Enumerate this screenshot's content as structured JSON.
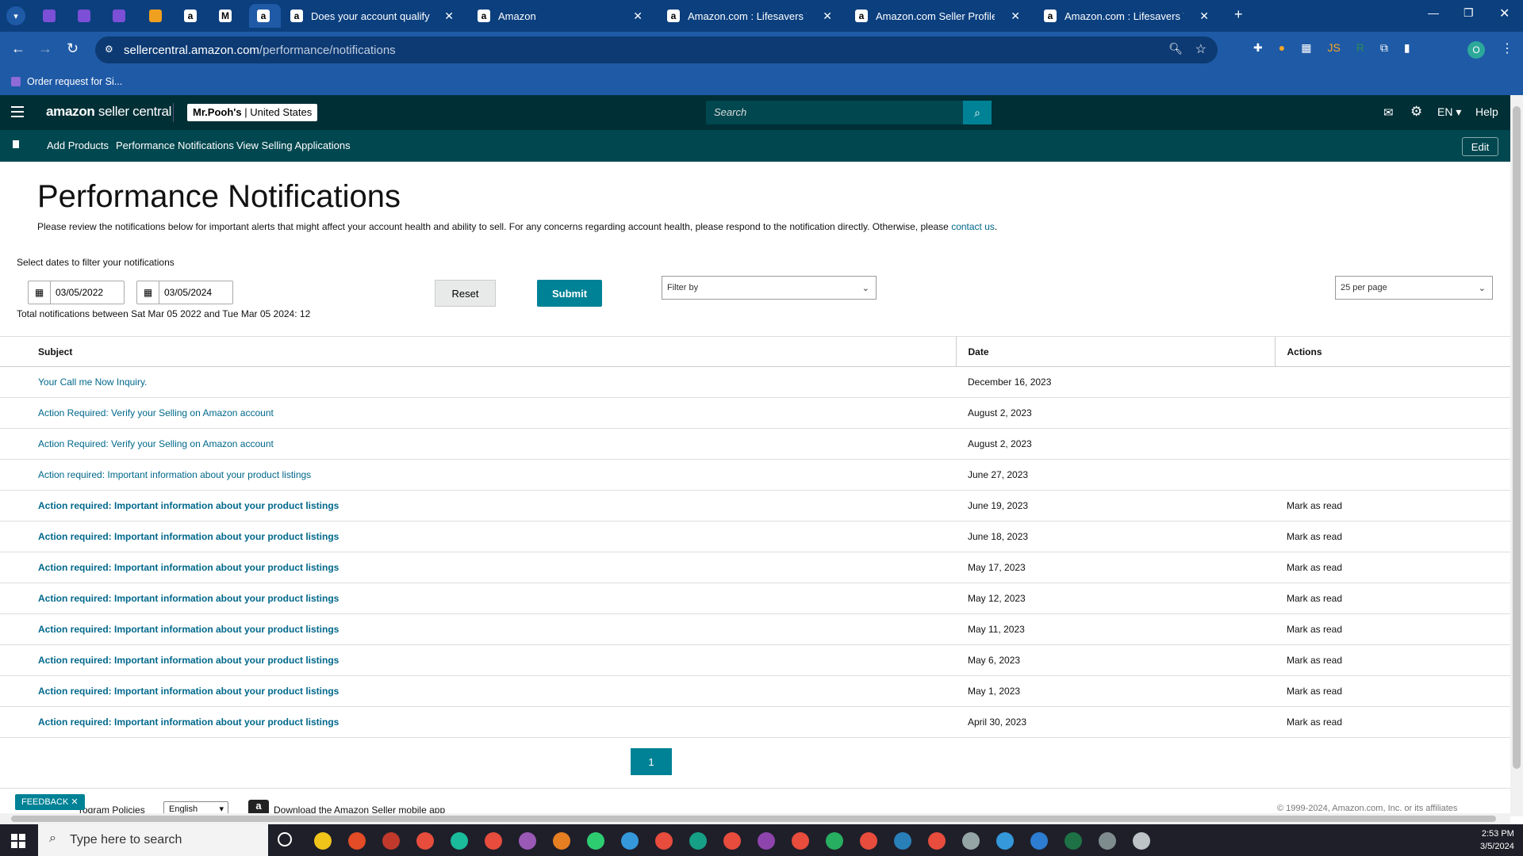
{
  "browser": {
    "tabs": [
      {
        "label": "",
        "icon": "tasks-icon"
      },
      {
        "label": "",
        "icon": "tasks-icon"
      },
      {
        "label": "",
        "icon": "tasks-icon"
      },
      {
        "label": "",
        "icon": "pen-icon"
      },
      {
        "label": "",
        "icon": "amazon-icon"
      },
      {
        "label": "",
        "icon": "gmail-icon"
      },
      {
        "label": "",
        "icon": "amazon-icon"
      },
      {
        "label": "Does your account qualify?",
        "icon": "amazon-icon"
      },
      {
        "label": "Amazon",
        "icon": "amazon-icon"
      },
      {
        "label": "Amazon.com : Lifesavers Wint",
        "icon": "amazon-icon"
      },
      {
        "label": "Amazon.com Seller Profile: Red",
        "icon": "amazon-icon"
      },
      {
        "label": "Amazon.com : Lifesavers Wint",
        "icon": "amazon-icon"
      }
    ],
    "url_host": "sellercentral.amazon.com",
    "url_path": "/performance/notifications",
    "bookmark": "Order request for Si...",
    "profile_initial": "O"
  },
  "header": {
    "logo_brand": "amazon",
    "logo_suffix": " seller central",
    "store_name": "Mr.Pooh's",
    "store_region": " | United States",
    "search_placeholder": "Search",
    "language": "EN",
    "help": "Help"
  },
  "nav": {
    "links": [
      "Add Products",
      "Performance Notifications",
      "View Selling Applications"
    ],
    "edit": "Edit"
  },
  "page": {
    "title": "Performance Notifications",
    "description": "Please review the notifications below for important alerts that might affect your account health and ability to sell. For any concerns regarding account health, please respond to the notification directly. Otherwise, please ",
    "contact_link": "contact us",
    "description_end": ".",
    "filter_label": "Select dates to filter your notifications",
    "date_from": "03/05/2022",
    "date_to": "03/05/2024",
    "total": "Total notifications between Sat Mar 05 2022 and Tue Mar 05 2024: 12",
    "reset": "Reset",
    "submit": "Submit",
    "filter_by": "Filter by",
    "per_page": "25 per page"
  },
  "table": {
    "headers": [
      "Subject",
      "Date",
      "Actions"
    ],
    "rows": [
      {
        "subject": "Your Call me Now Inquiry.",
        "date": "December 16, 2023",
        "action": "",
        "unread": false
      },
      {
        "subject": "Action Required: Verify your Selling on Amazon account",
        "date": "August 2, 2023",
        "action": "",
        "unread": false
      },
      {
        "subject": "Action Required: Verify your Selling on Amazon account",
        "date": "August 2, 2023",
        "action": "",
        "unread": false
      },
      {
        "subject": "Action required: Important information about your product listings",
        "date": "June 27, 2023",
        "action": "",
        "unread": false
      },
      {
        "subject": "Action required: Important information about your product listings",
        "date": "June 19, 2023",
        "action": "Mark as read",
        "unread": true
      },
      {
        "subject": "Action required: Important information about your product listings",
        "date": "June 18, 2023",
        "action": "Mark as read",
        "unread": true
      },
      {
        "subject": "Action required: Important information about your product listings",
        "date": "May 17, 2023",
        "action": "Mark as read",
        "unread": true
      },
      {
        "subject": "Action required: Important information about your product listings",
        "date": "May 12, 2023",
        "action": "Mark as read",
        "unread": true
      },
      {
        "subject": "Action required: Important information about your product listings",
        "date": "May 11, 2023",
        "action": "Mark as read",
        "unread": true
      },
      {
        "subject": "Action required: Important information about your product listings",
        "date": "May 6, 2023",
        "action": "Mark as read",
        "unread": true
      },
      {
        "subject": "Action required: Important information about your product listings",
        "date": "May 1, 2023",
        "action": "Mark as read",
        "unread": true
      },
      {
        "subject": "Action required: Important information about your product listings",
        "date": "April 30, 2023",
        "action": "Mark as read",
        "unread": true
      }
    ]
  },
  "pagination": {
    "current": "1"
  },
  "footer": {
    "feedback": "FEEDBACK ✕",
    "policies": "rogram Policies",
    "language": "English",
    "app_download": "Download the Amazon Seller mobile app",
    "copyright": "© 1999-2024, Amazon.com, Inc. or its affiliates"
  },
  "taskbar": {
    "search_placeholder": "Type here to search",
    "time": "2:53 PM",
    "date": "3/5/2024"
  },
  "colors": {
    "teal": "#008296",
    "header": "#002f36",
    "nav": "#00474f",
    "link": "#00688b",
    "browser": "#1f5aa6"
  }
}
